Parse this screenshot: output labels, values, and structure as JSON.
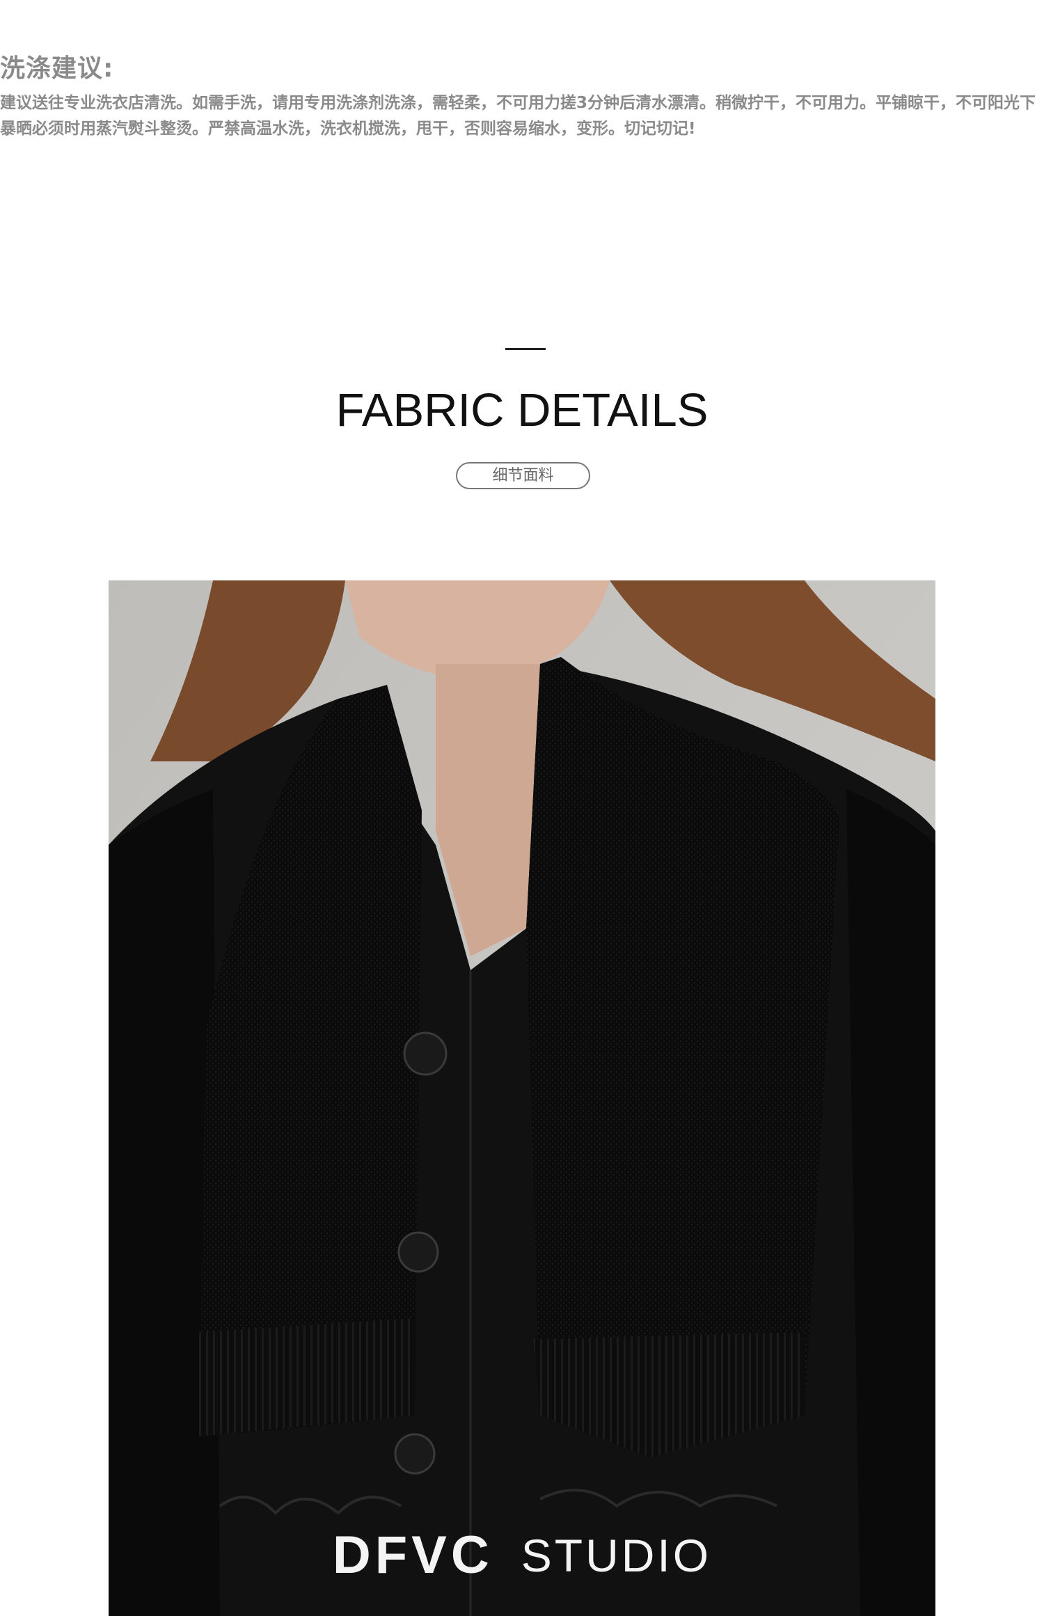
{
  "care": {
    "title": "洗涤建议:",
    "body": "建议送往专业洗衣店清洗。如需手洗，请用专用洗涤剂洗涤，需轻柔，不可用力搓3分钟后清水漂清。稍微拧干，不可用力。平铺晾干，不可阳光下暴晒必须时用蒸汽熨斗整烫。严禁高温水洗，洗衣机搅洗，甩干，否则容易缩水，变形。切记切记!"
  },
  "section": {
    "heading": "FABRIC DETAILS",
    "badge": "细节面料"
  },
  "photo": {
    "brand_logo": "DFVC",
    "brand_suffix": "STUDIO"
  },
  "colors": {
    "care_text": "#8a8a8a",
    "heading": "#111111",
    "garment": "#0c0c0c",
    "backdrop": "#c9c7c3",
    "brand": "#f4f4f4"
  }
}
